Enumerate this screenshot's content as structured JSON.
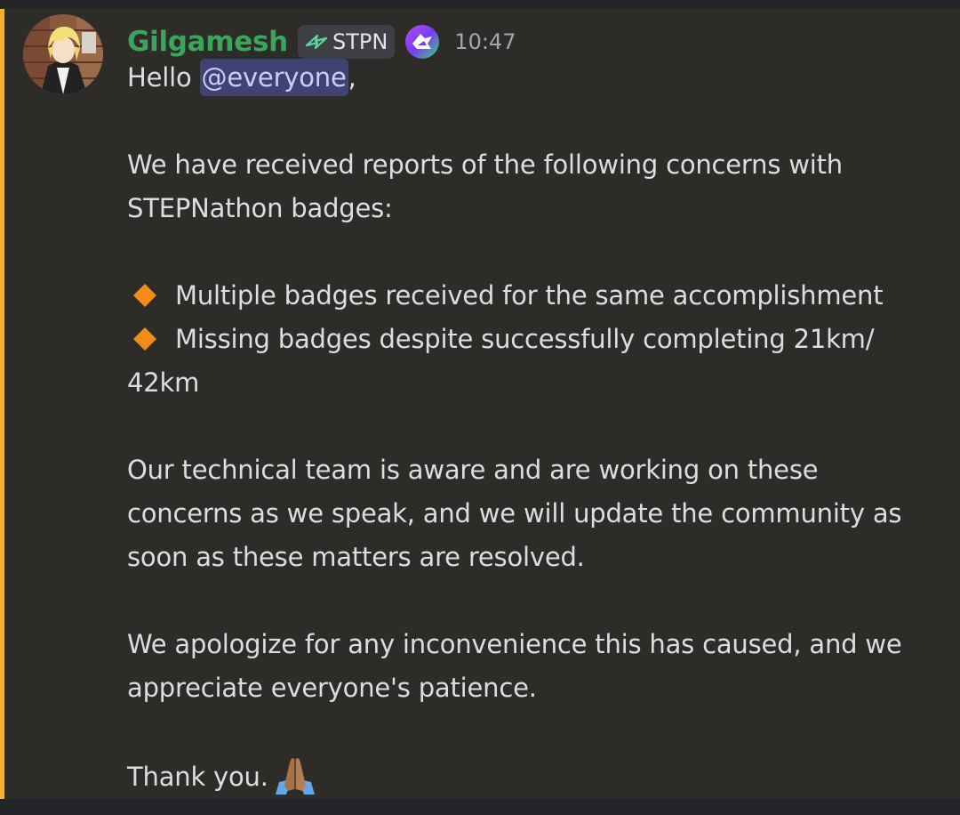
{
  "message": {
    "author": "Gilgamesh",
    "role_tag": "STPN",
    "timestamp": "10:47",
    "greeting_prefix": "Hello ",
    "mention": "@everyone",
    "greeting_suffix": ",",
    "paragraph_1_line_1": "We have received reports of the following concerns with",
    "paragraph_1_line_2": "STEPNathon badges:",
    "bullets": [
      "Multiple badges received for the same accomplishment",
      "Missing badges despite successfully completing 21km/"
    ],
    "bullet_2_continuation": "42km",
    "paragraph_2_lines": [
      "Our technical team is aware and are working on these",
      "concerns as we speak, and we will update the community as",
      "soon as these matters are resolved."
    ],
    "paragraph_3_lines": [
      "We apologize for any inconvenience this has caused, and we",
      "appreciate everyone's patience."
    ],
    "closing": "Thank you.",
    "closing_emoji": "folded-hands-emoji"
  },
  "colors": {
    "username": "#3ba55c",
    "mention_highlight_bar": "#f0b232",
    "mention_background": "#3e4372",
    "bullet": "#f28c18"
  }
}
